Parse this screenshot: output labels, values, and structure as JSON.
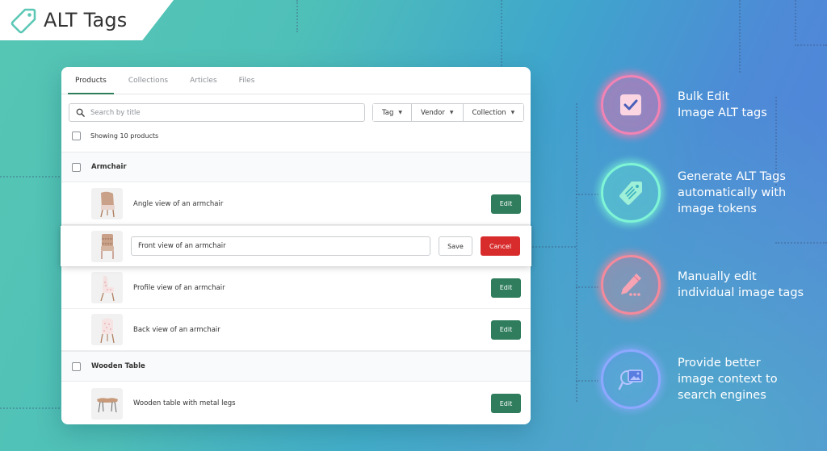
{
  "brand": {
    "name": "ALT Tags",
    "icon": "tag-icon"
  },
  "colors": {
    "accent_green": "#2f7d5d",
    "cancel_red": "#d82c2c",
    "ring_pink": "#f07aa6",
    "ring_teal": "#6ff0d0",
    "ring_coral": "#f08a9a",
    "ring_blue": "#8fa8ff"
  },
  "tabs": [
    {
      "label": "Products",
      "active": true
    },
    {
      "label": "Collections",
      "active": false
    },
    {
      "label": "Articles",
      "active": false
    },
    {
      "label": "Files",
      "active": false
    }
  ],
  "search": {
    "placeholder": "Search by title",
    "value": "",
    "icon": "search-icon"
  },
  "filters": [
    {
      "label": "Tag",
      "icon": "caret-down-icon"
    },
    {
      "label": "Vendor",
      "icon": "caret-down-icon"
    },
    {
      "label": "Collection",
      "icon": "caret-down-icon"
    }
  ],
  "showing_label": "Showing 10 products",
  "groups": [
    {
      "title": "Armchair",
      "items": [
        {
          "alt": "Angle view of an armchair",
          "action": "Edit"
        },
        {
          "alt": "Front view of an armchair",
          "editing": true,
          "save": "Save",
          "cancel": "Cancel"
        },
        {
          "alt": "Profile view of an armchair",
          "action": "Edit"
        },
        {
          "alt": "Back view of an armchair",
          "action": "Edit"
        }
      ]
    },
    {
      "title": "Wooden Table",
      "items": [
        {
          "alt": "Wooden table with metal legs",
          "action": "Edit"
        }
      ]
    }
  ],
  "features": [
    {
      "icon": "checkbox-icon",
      "line1": "Bulk Edit",
      "line2": "Image ALT tags",
      "line3": ""
    },
    {
      "icon": "tag-icon",
      "line1": "Generate ALT Tags",
      "line2": "automatically with",
      "line3": "image tokens"
    },
    {
      "icon": "pencil-icon",
      "line1": "Manually edit",
      "line2": "individual image tags",
      "line3": ""
    },
    {
      "icon": "image-search-icon",
      "line1": "Provide better",
      "line2": "image context to",
      "line3": "search engines"
    }
  ]
}
